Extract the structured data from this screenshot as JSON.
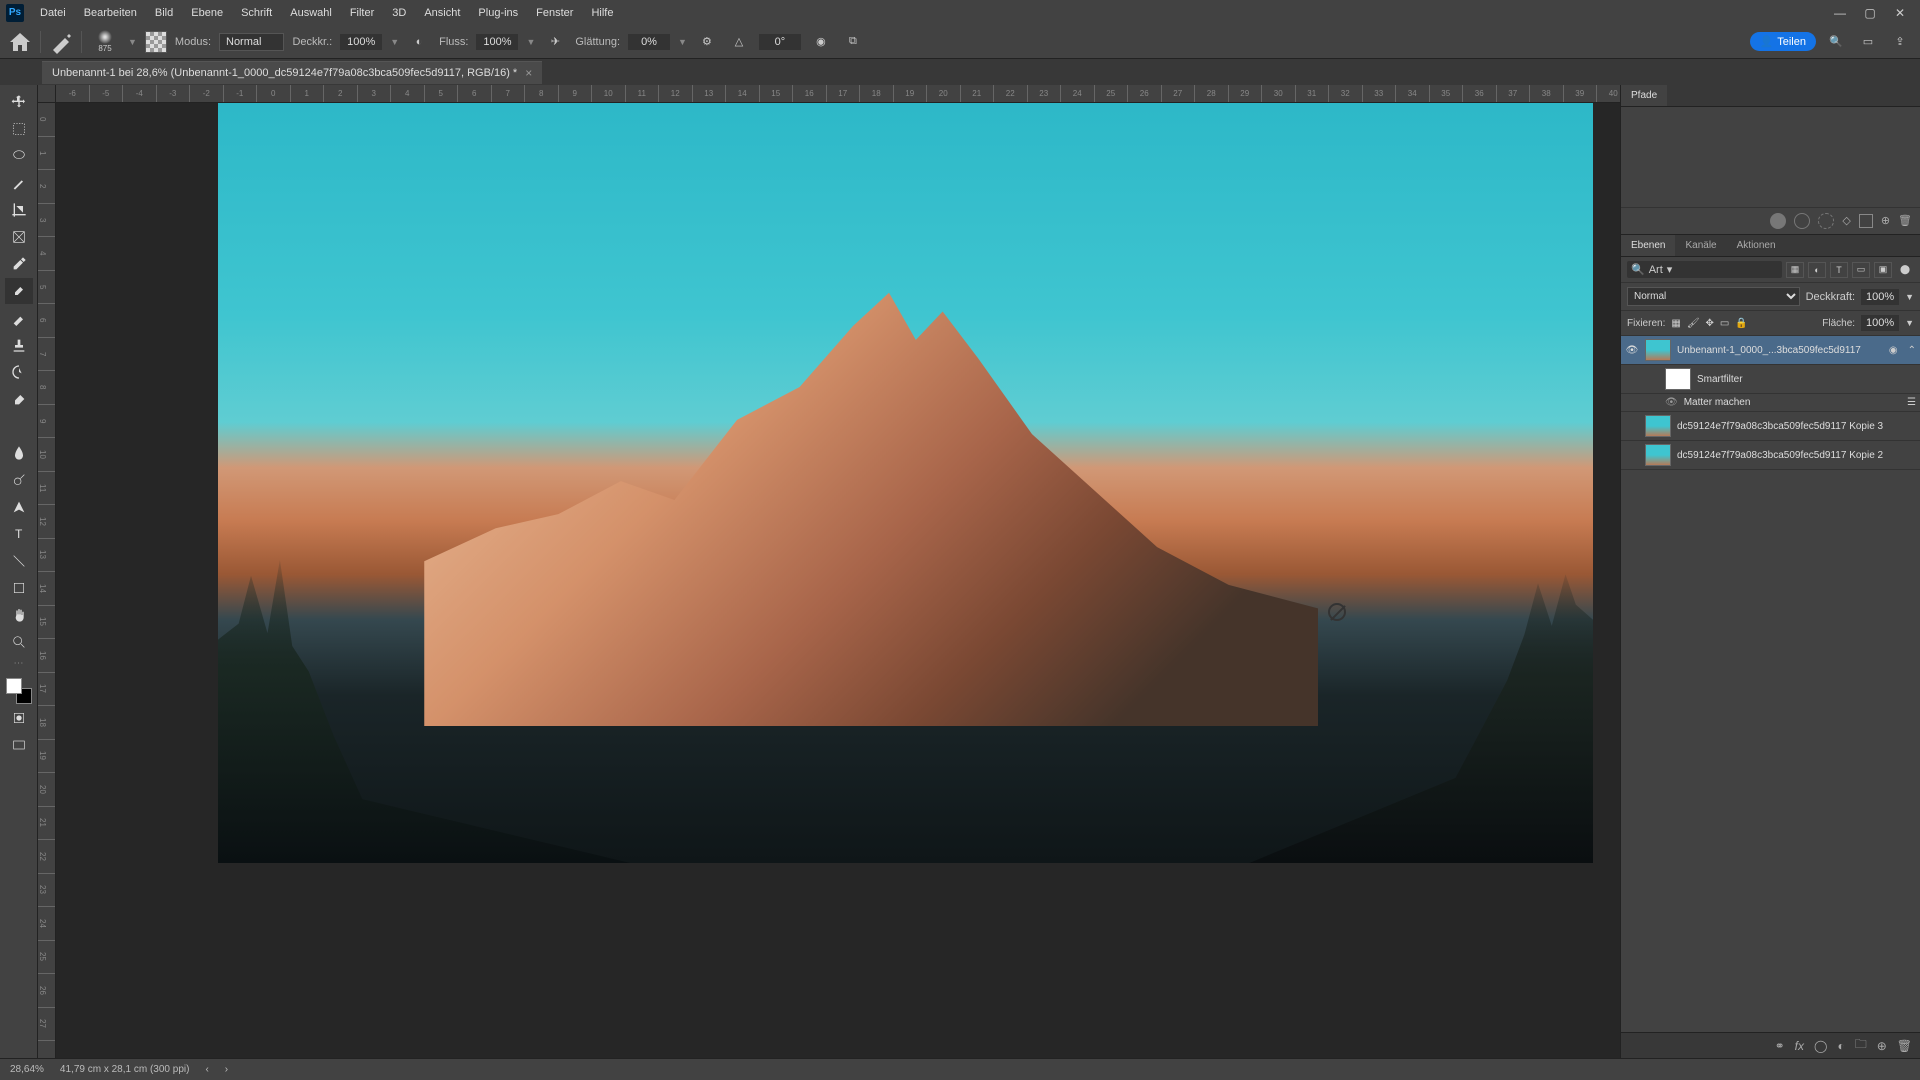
{
  "menu": [
    "Datei",
    "Bearbeiten",
    "Bild",
    "Ebene",
    "Schrift",
    "Auswahl",
    "Filter",
    "3D",
    "Ansicht",
    "Plug-ins",
    "Fenster",
    "Hilfe"
  ],
  "options": {
    "mode_label": "Modus:",
    "mode_value": "Normal",
    "opacity_label": "Deckkr.:",
    "opacity_value": "100%",
    "flow_label": "Fluss:",
    "flow_value": "100%",
    "smoothing_label": "Glättung:",
    "smoothing_value": "0%",
    "angle_value": "0°",
    "brush_size": "875",
    "share": "Teilen"
  },
  "doc_tab": "Unbenannt-1 bei 28,6% (Unbenannt-1_0000_dc59124e7f79a08c3bca509fec5d9117, RGB/16) *",
  "ruler_h": [
    "-6",
    "-5",
    "-4",
    "-3",
    "-2",
    "-1",
    "0",
    "1",
    "2",
    "3",
    "4",
    "5",
    "6",
    "7",
    "8",
    "9",
    "10",
    "11",
    "12",
    "13",
    "14",
    "15",
    "16",
    "17",
    "18",
    "19",
    "20",
    "21",
    "22",
    "23",
    "24",
    "25",
    "26",
    "27",
    "28",
    "29",
    "30",
    "31",
    "32",
    "33",
    "34",
    "35",
    "36",
    "37",
    "38",
    "39",
    "40"
  ],
  "ruler_v": [
    "0",
    "1",
    "2",
    "3",
    "4",
    "5",
    "6",
    "7",
    "8",
    "9",
    "10",
    "11",
    "12",
    "13",
    "14",
    "15",
    "16",
    "17",
    "18",
    "19",
    "20",
    "21",
    "22",
    "23",
    "24",
    "25",
    "26",
    "27"
  ],
  "panels": {
    "paths_tab": "Pfade",
    "layers_tabs": [
      "Ebenen",
      "Kanäle",
      "Aktionen"
    ],
    "search_label": "Art",
    "blend_mode": "Normal",
    "opacity_label": "Deckkraft:",
    "opacity_value": "100%",
    "lock_label": "Fixieren:",
    "fill_label": "Fläche:",
    "fill_value": "100%",
    "layers": [
      {
        "name": "Unbenannt-1_0000_...3bca509fec5d9117",
        "visible": true,
        "selected": true,
        "smart": true
      },
      {
        "name": "Smartfilter",
        "sub": true,
        "thumb": "white"
      },
      {
        "name": "Matter machen",
        "sub": true,
        "link": true
      },
      {
        "name": "dc59124e7f79a08c3bca509fec5d9117 Kopie 3",
        "visible": false
      },
      {
        "name": "dc59124e7f79a08c3bca509fec5d9117 Kopie 2",
        "visible": false
      }
    ]
  },
  "status": {
    "zoom": "28,64%",
    "dims": "41,79 cm x 28,1 cm (300 ppi)"
  }
}
